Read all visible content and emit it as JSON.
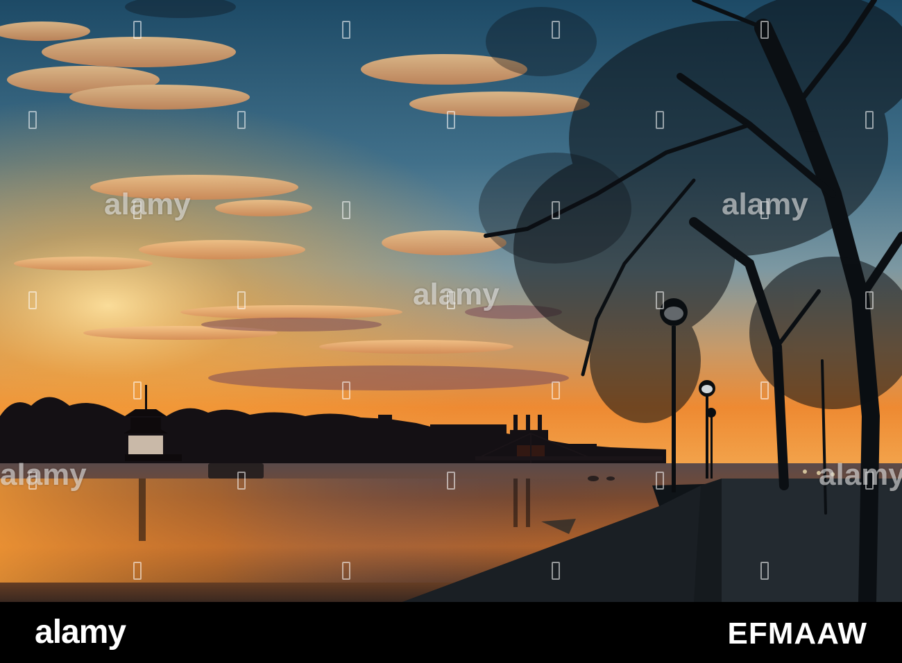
{
  "watermark": {
    "brand": "alamy",
    "colour": "#ffffff"
  },
  "footer": {
    "logo_text": "alamy",
    "image_id": "EFMAAW",
    "background": "#000000",
    "text_colour": "#ffffff"
  },
  "scene": {
    "sky_top": "#1f4a66",
    "sky_mid": "#6b8ea0",
    "sky_horizon": "#f0902a",
    "sun_glow": "#ffd27a",
    "water": "#3a2a25",
    "silhouette": "#0c1116"
  }
}
